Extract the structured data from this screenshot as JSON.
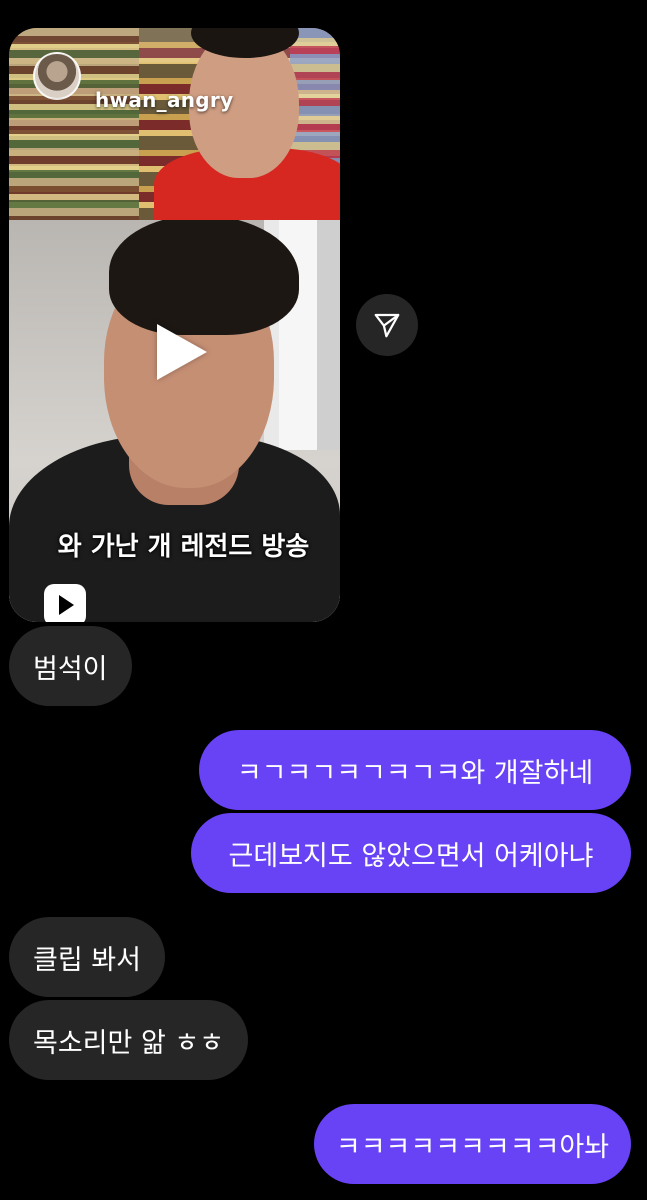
{
  "shared_reel": {
    "username": "hwan_angry",
    "caption": "와 가난 개 레전드 방송",
    "reel_icon": "reels-icon",
    "play_icon": "play-icon"
  },
  "share_button": {
    "icon": "send-icon"
  },
  "messages": [
    {
      "side": "received",
      "text": "범석이"
    },
    {
      "side": "sent",
      "text": "ㅋㄱㅋㄱㅋㄱㅋㄱㅋ와 개잘하네"
    },
    {
      "side": "sent",
      "text": "근데보지도 않았으면서 어케아냐"
    },
    {
      "side": "received",
      "text": "클립 봐서"
    },
    {
      "side": "received",
      "text": "목소리만 앎 ㅎㅎ"
    },
    {
      "side": "sent",
      "text": "ㅋㅋㅋㅋㅋㅋㅋㅋㅋ아놔"
    }
  ],
  "colors": {
    "background": "#000000",
    "received_bubble": "#262626",
    "sent_bubble": "#6842f5"
  }
}
